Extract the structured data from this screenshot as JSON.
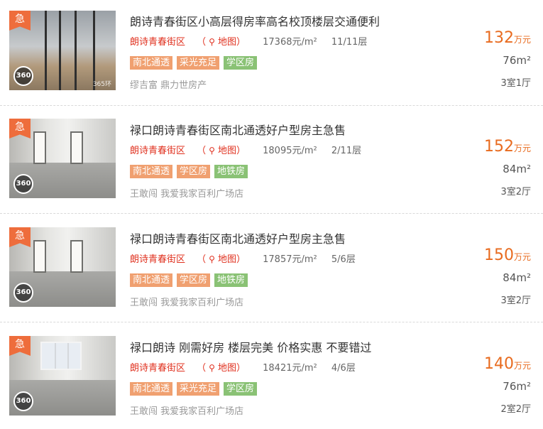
{
  "icons": {
    "urgent_label": "急",
    "pano_label": "360",
    "map_pin": "map-pin-icon"
  },
  "colors": {
    "accent_red": "#e0301e",
    "price_orange": "#e86b1f",
    "tag_orange": "#f0a070",
    "tag_green": "#8ac275",
    "urgent_badge": "#ee6d3c"
  },
  "listings": [
    {
      "title": "朗诗青春街区小高层得房率高名校顶楼层交通便利",
      "community": "朗诗青春街区",
      "map_label": "地图",
      "unit_price": "17368元/m²",
      "floor": "11/11层",
      "tags": [
        {
          "label": "南北通透",
          "color": "orange"
        },
        {
          "label": "采光充足",
          "color": "orange"
        },
        {
          "label": "学区房",
          "color": "green"
        }
      ],
      "agent": "缪吉富 鼎力世房产",
      "price": "132",
      "price_unit": "万元",
      "area": "76m²",
      "layout": "3室1厅",
      "watermark": "365环"
    },
    {
      "title": "禄口朗诗青春街区南北通透好户型房主急售",
      "community": "朗诗青春街区",
      "map_label": "地图",
      "unit_price": "18095元/m²",
      "floor": "2/11层",
      "tags": [
        {
          "label": "南北通透",
          "color": "orange"
        },
        {
          "label": "学区房",
          "color": "orange"
        },
        {
          "label": "地铁房",
          "color": "green"
        }
      ],
      "agent": "王敢闯 我爱我家百利广场店",
      "price": "152",
      "price_unit": "万元",
      "area": "84m²",
      "layout": "3室2厅"
    },
    {
      "title": "禄口朗诗青春街区南北通透好户型房主急售",
      "community": "朗诗青春街区",
      "map_label": "地图",
      "unit_price": "17857元/m²",
      "floor": "5/6层",
      "tags": [
        {
          "label": "南北通透",
          "color": "orange"
        },
        {
          "label": "学区房",
          "color": "orange"
        },
        {
          "label": "地铁房",
          "color": "green"
        }
      ],
      "agent": "王敢闯 我爱我家百利广场店",
      "price": "150",
      "price_unit": "万元",
      "area": "84m²",
      "layout": "3室2厅"
    },
    {
      "title": "禄口朗诗 刚需好房 楼层完美 价格实惠 不要错过",
      "community": "朗诗青春街区",
      "map_label": "地图",
      "unit_price": "18421元/m²",
      "floor": "4/6层",
      "tags": [
        {
          "label": "南北通透",
          "color": "orange"
        },
        {
          "label": "采光充足",
          "color": "orange"
        },
        {
          "label": "学区房",
          "color": "green"
        }
      ],
      "agent": "王敢闯 我爱我家百利广场店",
      "price": "140",
      "price_unit": "万元",
      "area": "76m²",
      "layout": "2室2厅"
    }
  ]
}
